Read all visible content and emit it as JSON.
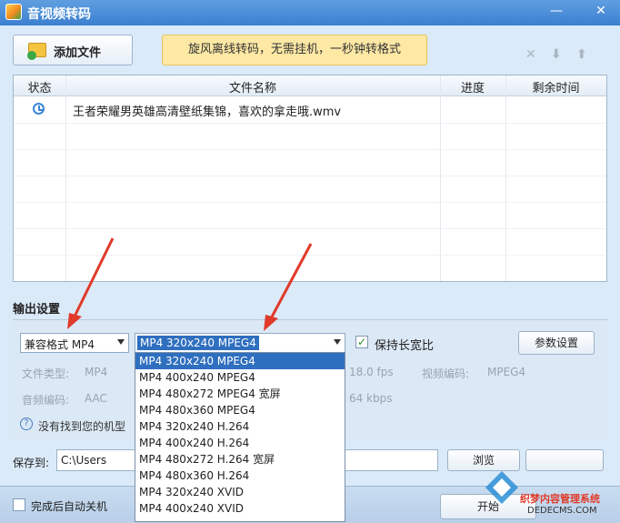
{
  "window": {
    "title": "音视频转码",
    "controls": {
      "minimize": "—",
      "maximize": "⊟",
      "close": "✕"
    }
  },
  "toolbar": {
    "add_file": "添加文件",
    "promo": "旋风离线转码，无需挂机，一秒钟转格式",
    "delete_symbol": "✕",
    "down_symbol": "⬇",
    "up_symbol": "⬆"
  },
  "table": {
    "headers": [
      "状态",
      "文件名称",
      "进度",
      "剩余时间"
    ],
    "rows": [
      {
        "status_icon": "clock-icon",
        "name": "王者荣耀男英雄高清壁纸集锦，喜欢的拿走哦.wmv",
        "progress": "",
        "remaining": ""
      }
    ]
  },
  "output": {
    "label": "输出设置",
    "format": "兼容格式 MP4",
    "preset": "MP4 320x240 MPEG4",
    "keep_ratio_label": "保持长宽比",
    "keep_ratio_checked": true,
    "param_button": "参数设置",
    "file_type_label": "文件类型:",
    "file_type_value": "MP4",
    "audio_codec_label": "音频编码:",
    "audio_codec_value": "AAC",
    "fps_value": "18.0 fps",
    "video_codec_label": "视频编码:",
    "video_codec_value": "MPEG4",
    "bitrate_value": "64 kbps",
    "hint": "没有找到您的机型"
  },
  "preset_options": [
    "MP4 320x240 MPEG4",
    "MP4 400x240 MPEG4",
    "MP4 480x272 MPEG4 宽屏",
    "MP4 480x360 MPEG4",
    "MP4 320x240 H.264",
    "MP4 400x240 H.264",
    "MP4 480x272 H.264 宽屏",
    "MP4 480x360 H.264",
    "MP4 320x240 XVID",
    "MP4 400x240 XVID"
  ],
  "save": {
    "label": "保存到:",
    "path": "C:\\Users",
    "browse": "浏览"
  },
  "bottom": {
    "auto_shutdown": "完成后自动关机",
    "start": "开始"
  },
  "watermark": {
    "line1": "织梦内容管理系统",
    "line2": "DEDECMS.COM"
  },
  "colors": {
    "accent": "#2f6fbf",
    "annotation_red": "#e03a2a",
    "promo_bg": "#fde8a4"
  }
}
